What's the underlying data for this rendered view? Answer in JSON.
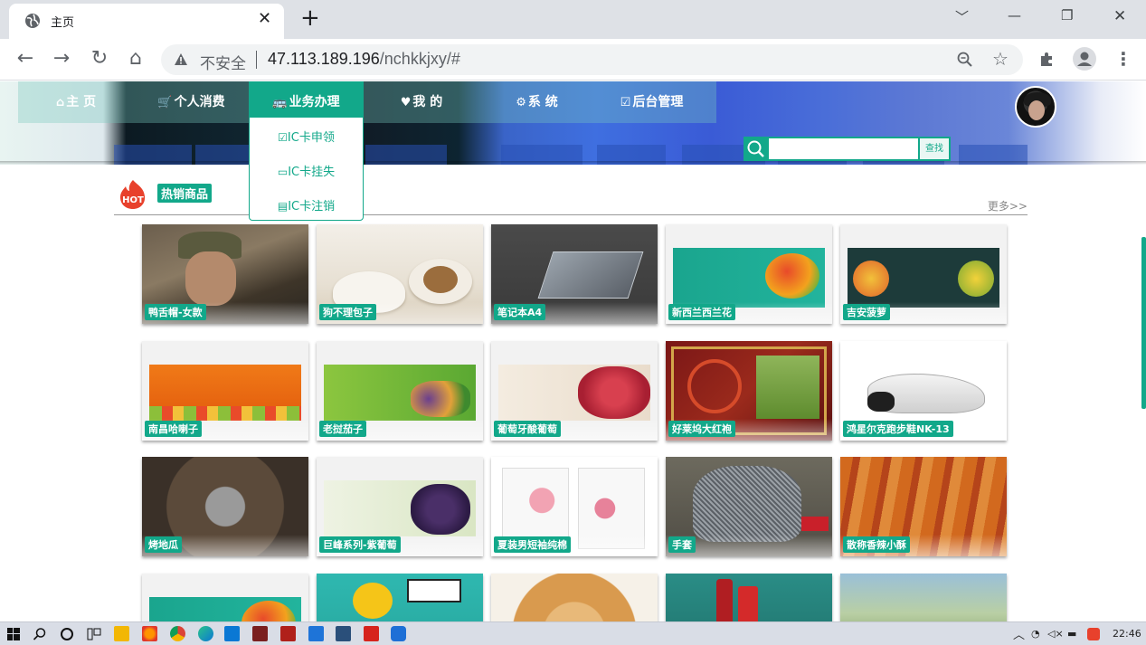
{
  "browser": {
    "tab_title": "主页",
    "tab_close": "✕",
    "new_tab": "+",
    "insecure_label": "不安全",
    "url_host": "47.113.189.196",
    "url_path": "/nchkkjxy/#"
  },
  "nav": {
    "items": [
      {
        "icon": "⌂",
        "label": "主 页"
      },
      {
        "icon": "🛒",
        "label": "个人消费"
      },
      {
        "icon": "🚌",
        "label": "业务办理"
      },
      {
        "icon": "♥",
        "label": "我 的"
      },
      {
        "icon": "⚙",
        "label": "系 统"
      },
      {
        "icon": "☑",
        "label": "后台管理"
      }
    ],
    "dropdown": [
      {
        "icon": "☑",
        "label": "IC卡申领"
      },
      {
        "icon": "▭",
        "label": "IC卡挂失"
      },
      {
        "icon": "▤",
        "label": "IC卡注销"
      }
    ]
  },
  "search": {
    "placeholder": "",
    "button_label": "查找"
  },
  "section": {
    "hot_text": "HOT",
    "title": "热销商品",
    "more": "更多>>"
  },
  "products": [
    {
      "name": "鸭舌帽-女款"
    },
    {
      "name": "狗不理包子"
    },
    {
      "name": "笔记本A4"
    },
    {
      "name": "新西兰西兰花"
    },
    {
      "name": "吉安菠萝"
    },
    {
      "name": "南昌哈喇子"
    },
    {
      "name": "老挝茄子"
    },
    {
      "name": "葡萄牙酸葡萄"
    },
    {
      "name": "好莱坞大红袍"
    },
    {
      "name": "鸿星尔克跑步鞋NK-13"
    },
    {
      "name": "烤地瓜"
    },
    {
      "name": "巨峰系列-紫葡萄"
    },
    {
      "name": "夏装男短袖纯棉"
    },
    {
      "name": "手套"
    },
    {
      "name": "散称香辣小酥"
    },
    {
      "name": ""
    },
    {
      "name": ""
    },
    {
      "name": ""
    },
    {
      "name": ""
    },
    {
      "name": ""
    }
  ],
  "taskbar": {
    "time": "22:46"
  },
  "colors": {
    "accent": "#12a88a"
  }
}
